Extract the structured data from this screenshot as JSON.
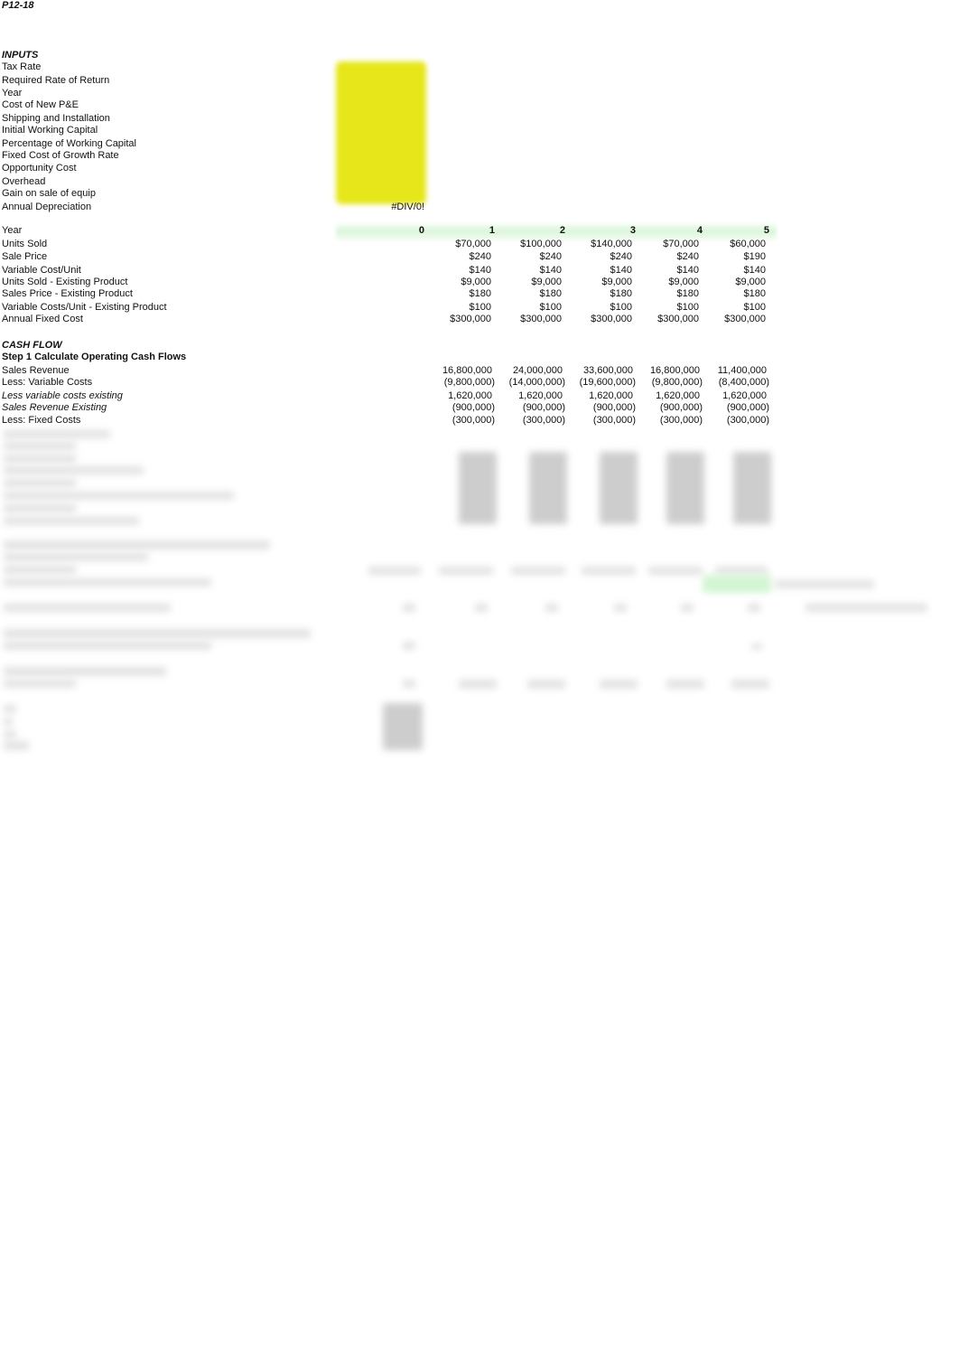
{
  "sheet_title": "P12-18",
  "inputs": {
    "header": "INPUTS",
    "labels": [
      "Tax Rate",
      "Required Rate of Return",
      "Year",
      "Cost of New P&E",
      "Shipping and Installation",
      "Initial Working Capital",
      "Percentage of Working Capital",
      "Fixed Cost of Growth Rate",
      "Opportunity Cost",
      "Overhead",
      "Gain on sale of equip",
      "Annual Depreciation"
    ],
    "annual_depreciation_value": "#DIV/0!",
    "input_cell_color": "#e6e61a"
  },
  "schedule": {
    "year_label": "Year",
    "years": [
      "0",
      "1",
      "2",
      "3",
      "4",
      "5"
    ],
    "header_band_color": "#d7f5d7",
    "rows": [
      {
        "label": "Units Sold",
        "values": [
          "$70,000",
          "$100,000",
          "$140,000",
          "$70,000",
          "$60,000"
        ]
      },
      {
        "label": "Sale Price",
        "values": [
          "$240",
          "$240",
          "$240",
          "$240",
          "$190"
        ]
      },
      {
        "label": "Variable Cost/Unit",
        "values": [
          "$140",
          "$140",
          "$140",
          "$140",
          "$140"
        ]
      },
      {
        "label": "Units Sold - Existing Product",
        "values": [
          "$9,000",
          "$9,000",
          "$9,000",
          "$9,000",
          "$9,000"
        ]
      },
      {
        "label": "Sales Price - Existing Product",
        "values": [
          "$180",
          "$180",
          "$180",
          "$180",
          "$180"
        ]
      },
      {
        "label": "Variable Costs/Unit - Existing Product",
        "values": [
          "$100",
          "$100",
          "$100",
          "$100",
          "$100"
        ]
      },
      {
        "label": "Annual Fixed Cost",
        "values": [
          "$300,000",
          "$300,000",
          "$300,000",
          "$300,000",
          "$300,000"
        ]
      }
    ]
  },
  "cash_flow": {
    "header": "CASH FLOW",
    "step1_title": "Step 1 Calculate Operating Cash Flows",
    "rows": [
      {
        "label": "Sales Revenue",
        "italic": false,
        "values": [
          "16,800,000",
          "24,000,000",
          "33,600,000",
          "16,800,000",
          "11,400,000"
        ]
      },
      {
        "label": "Less: Variable Costs",
        "italic": false,
        "values": [
          "(9,800,000)",
          "(14,000,000)",
          "(19,600,000)",
          "(9,800,000)",
          "(8,400,000)"
        ]
      },
      {
        "label": "Less variable costs existing",
        "italic": true,
        "values": [
          "1,620,000",
          "1,620,000",
          "1,620,000",
          "1,620,000",
          "1,620,000"
        ]
      },
      {
        "label": "Sales Revenue Existing",
        "italic": true,
        "values": [
          "(900,000)",
          "(900,000)",
          "(900,000)",
          "(900,000)",
          "(900,000)"
        ]
      },
      {
        "label": "Less: Fixed Costs",
        "italic": false,
        "values": [
          "(300,000)",
          "(300,000)",
          "(300,000)",
          "(300,000)",
          "(300,000)"
        ]
      }
    ]
  }
}
